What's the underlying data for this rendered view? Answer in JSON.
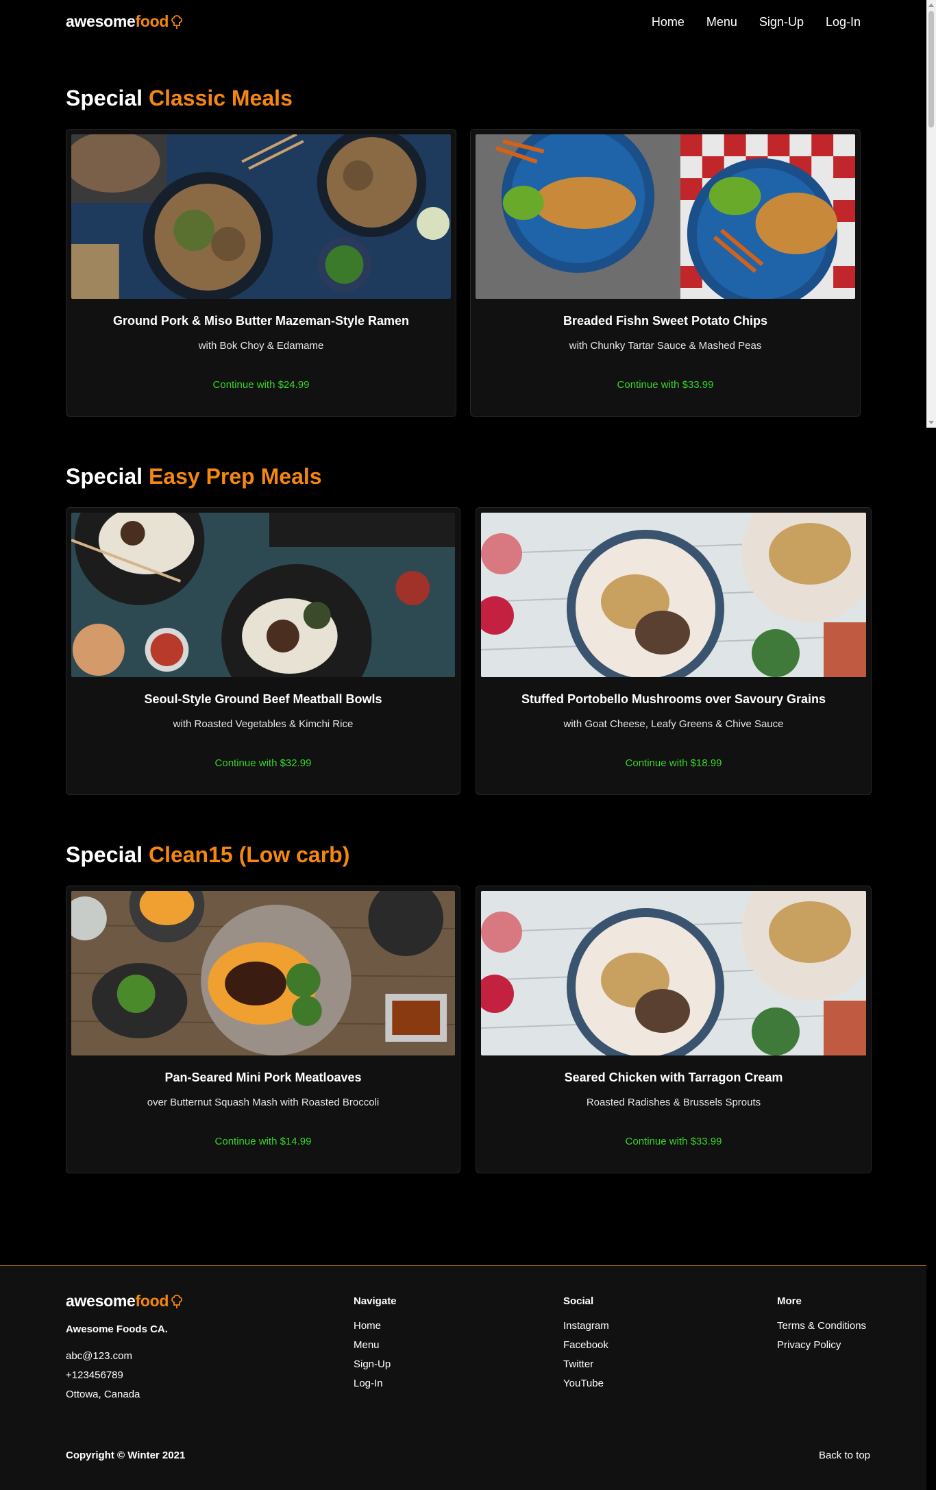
{
  "brand": {
    "logo_white": "awesome",
    "logo_orange": "food",
    "accent_color": "#f5870f",
    "price_color": "#39d42a",
    "logo_icon": "chef-hat-icon"
  },
  "nav": {
    "items": [
      "Home",
      "Menu",
      "Sign-Up",
      "Log-In"
    ]
  },
  "sections": [
    {
      "prefix": "Special",
      "highlight": "Classic Meals",
      "cards": [
        {
          "title": "Ground Pork & Miso Butter Mazeman-Style Ramen",
          "subtitle": "with Bok Choy & Edamame",
          "price": "Continue with $24.99",
          "image": "ramen-bowls-image"
        },
        {
          "title": "Breaded Fishn Sweet Potato Chips",
          "subtitle": "with Chunky Tartar Sauce & Mashed Peas",
          "price": "Continue with $33.99",
          "image": "fish-chips-image"
        }
      ]
    },
    {
      "prefix": "Special",
      "highlight": "Easy Prep Meals",
      "cards": [
        {
          "title": "Seoul-Style Ground Beef Meatball Bowls",
          "subtitle": "with Roasted Vegetables & Kimchi Rice",
          "price": "Continue with $32.99",
          "image": "meatball-bowls-image"
        },
        {
          "title": "Stuffed Portobello Mushrooms over Savoury Grains",
          "subtitle": "with Goat Cheese, Leafy Greens & Chive Sauce",
          "price": "Continue with $18.99",
          "image": "stuffed-mushrooms-image"
        }
      ]
    },
    {
      "prefix": "Special",
      "highlight": "Clean15 (Low carb)",
      "cards": [
        {
          "title": "Pan-Seared Mini Pork Meatloaves",
          "subtitle": "over Butternut Squash Mash with Roasted Broccoli",
          "price": "Continue with $14.99",
          "image": "meatloaf-image"
        },
        {
          "title": "Seared Chicken with Tarragon Cream",
          "subtitle": "Roasted Radishes & Brussels Sprouts",
          "price": "Continue with $33.99",
          "image": "seared-chicken-image"
        }
      ]
    }
  ],
  "footer": {
    "company": "Awesome Foods CA.",
    "email": "abc@123.com",
    "phone": "+123456789",
    "location": "Ottowa, Canada",
    "columns": [
      {
        "heading": "Navigate",
        "links": [
          "Home",
          "Menu",
          "Sign-Up",
          "Log-In"
        ]
      },
      {
        "heading": "Social",
        "links": [
          "Instagram",
          "Facebook",
          "Twitter",
          "YouTube"
        ]
      },
      {
        "heading": "More",
        "links": [
          "Terms & Conditions",
          "Privacy Policy"
        ]
      }
    ],
    "copyright": "Copyright © Winter 2021",
    "back_to_top": "Back to top"
  }
}
